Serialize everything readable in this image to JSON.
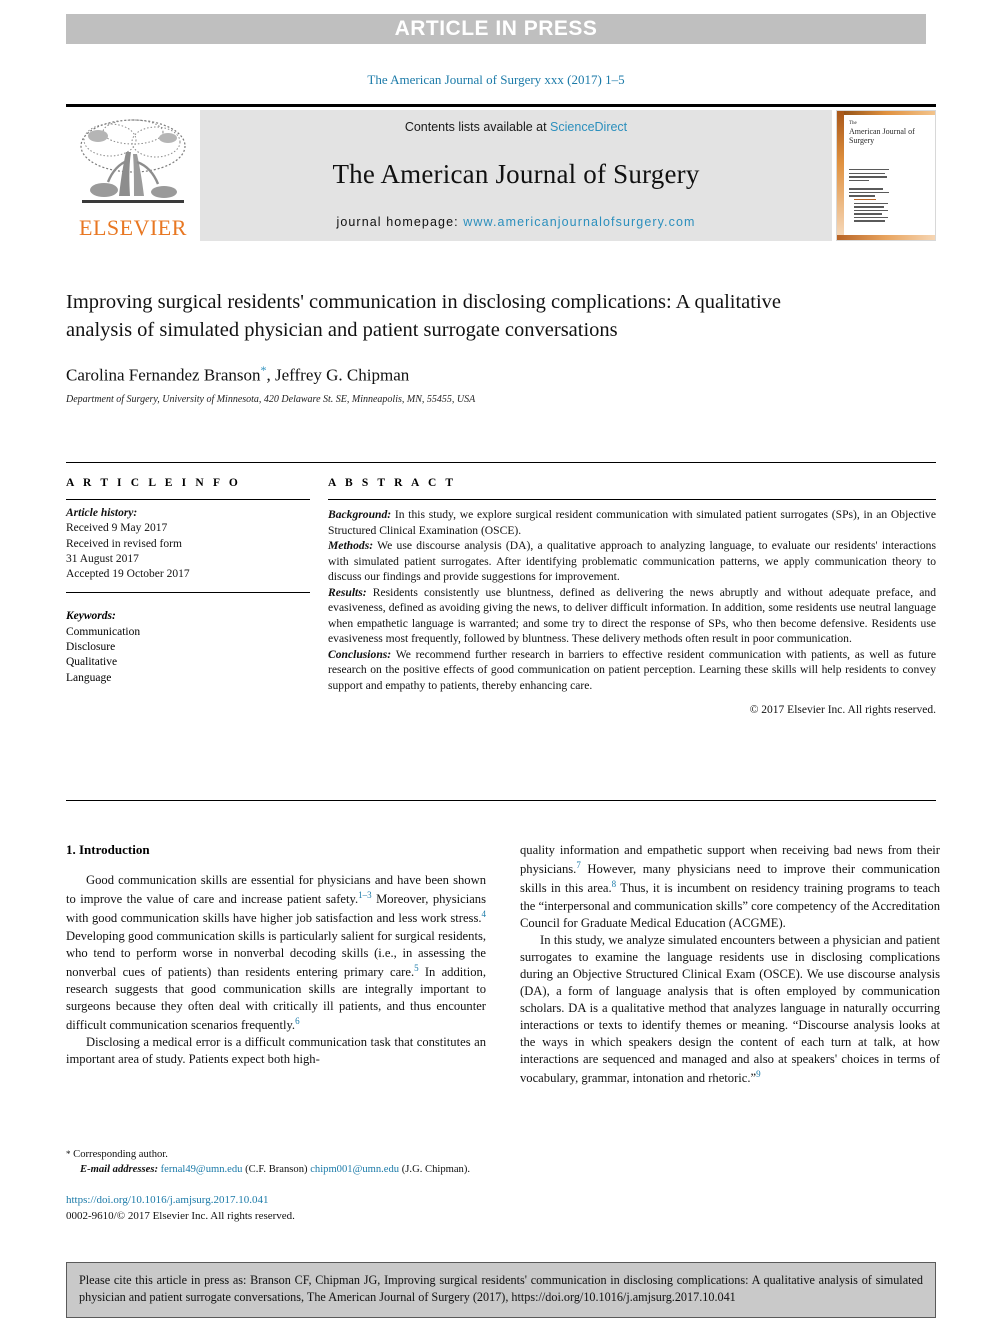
{
  "banner": {
    "text": "ARTICLE IN PRESS"
  },
  "journal_ref": "The American Journal of Surgery xxx (2017) 1–5",
  "masthead": {
    "contents_prefix": "Contents lists available at ",
    "sciencedirect": "ScienceDirect",
    "journal_title": "The American Journal of Surgery",
    "homepage_label": "journal homepage: ",
    "homepage_url": "www.americanjournalofsurgery.com",
    "publisher": "ELSEVIER",
    "cover_the": "The",
    "cover_title": "American Journal of Surgery"
  },
  "article": {
    "title": "Improving surgical residents' communication in disclosing complications: A qualitative analysis of simulated physician and patient surrogate conversations",
    "authors": "Carolina Fernandez Branson",
    "authors_second": ", Jeffrey G. Chipman",
    "corresponding_marker": "*",
    "affiliation": "Department of Surgery, University of Minnesota, 420 Delaware St. SE, Minneapolis, MN, 55455, USA"
  },
  "info": {
    "heading": "A R T I C L E   I N F O",
    "history_label": "Article history:",
    "history": [
      "Received 9 May 2017",
      "Received in revised form",
      "31 August 2017",
      "Accepted 19 October 2017"
    ],
    "keywords_label": "Keywords:",
    "keywords": [
      "Communication",
      "Disclosure",
      "Qualitative",
      "Language"
    ]
  },
  "abstract": {
    "heading": "A B S T R A C T",
    "sections": [
      {
        "label": "Background:",
        "text": " In this study, we explore surgical resident communication with simulated patient surrogates (SPs), in an Objective Structured Clinical Examination (OSCE)."
      },
      {
        "label": "Methods:",
        "text": " We use discourse analysis (DA), a qualitative approach to analyzing language, to evaluate our residents' interactions with simulated patient surrogates. After identifying problematic communication patterns, we apply communication theory to discuss our findings and provide suggestions for improvement."
      },
      {
        "label": "Results:",
        "text": " Residents consistently use bluntness, defined as delivering the news abruptly and without adequate preface, and evasiveness, defined as avoiding giving the news, to deliver difficult information. In addition, some residents use neutral language when empathetic language is warranted; and some try to direct the response of SPs, who then become defensive. Residents use evasiveness most frequently, followed by bluntness. These delivery methods often result in poor communication."
      },
      {
        "label": "Conclusions:",
        "text": " We recommend further research in barriers to effective resident communication with patients, as well as future research on the positive effects of good communication on patient perception. Learning these skills will help residents to convey support and empathy to patients, thereby enhancing care."
      }
    ],
    "copyright": "© 2017 Elsevier Inc. All rights reserved."
  },
  "body": {
    "section_heading": "1. Introduction",
    "left_paragraphs": [
      {
        "parts": [
          {
            "t": "Good communication skills are essential for physicians and have been shown to improve the value of care and increase patient safety."
          },
          {
            "ref": "1–3"
          },
          {
            "t": " Moreover, physicians with good communication skills have higher job satisfaction and less work stress."
          },
          {
            "ref": "4"
          },
          {
            "t": " Developing good communication skills is particularly salient for surgical residents, who tend to perform worse in nonverbal decoding skills (i.e., in assessing the nonverbal cues of patients) than residents entering primary care."
          },
          {
            "ref": "5"
          },
          {
            "t": " In addition, research suggests that good communication skills are integrally important to surgeons because they often deal with critically ill patients, and thus encounter difficult communication scenarios frequently."
          },
          {
            "ref": "6"
          }
        ]
      },
      {
        "parts": [
          {
            "t": "Disclosing a medical error is a difficult communication task that constitutes an important area of study. Patients expect both high-"
          }
        ]
      }
    ],
    "right_paragraphs": [
      {
        "no_indent": true,
        "parts": [
          {
            "t": "quality information and empathetic support when receiving bad news from their physicians."
          },
          {
            "ref": "7"
          },
          {
            "t": " However, many physicians need to improve their communication skills in this area."
          },
          {
            "ref": "8"
          },
          {
            "t": " Thus, it is incumbent on residency training programs to teach the “interpersonal and communication skills” core competency of the Accreditation Council for Graduate Medical Education (ACGME)."
          }
        ]
      },
      {
        "parts": [
          {
            "t": "In this study, we analyze simulated encounters between a physician and patient surrogates to examine the language residents use in disclosing complications during an Objective Structured Clinical Exam (OSCE). We use discourse analysis (DA), a form of language analysis that is often employed by communication scholars. DA is a qualitative method that analyzes language in naturally occurring interactions or texts to identify themes or meaning. “Discourse analysis looks at the ways in which speakers design the content of each turn at talk, at how interactions are sequenced and managed and also at speakers' choices in terms of vocabulary, grammar, intonation and rhetoric.”"
          },
          {
            "ref": "9"
          }
        ]
      }
    ]
  },
  "footnote": {
    "corresponding": "Corresponding author.",
    "email_label": "E-mail addresses:",
    "email_1": "fernal49@umn.edu",
    "email_1_owner": "(C.F. Branson)",
    "email_2": "chipm001@umn.edu",
    "email_2_owner": "(J.G. Chipman).",
    "doi": "https://doi.org/10.1016/j.amjsurg.2017.10.041",
    "issn_copyright": "0002-9610/© 2017 Elsevier Inc. All rights reserved."
  },
  "cite_box": {
    "text": "Please cite this article in press as: Branson CF, Chipman JG, Improving surgical residents' communication in disclosing complications: A qualitative analysis of simulated physician and patient surrogate conversations, The American Journal of Surgery (2017), https://doi.org/10.1016/j.amjsurg.2017.10.041"
  },
  "colors": {
    "link_blue": "#1b7aa8",
    "sciencedirect_blue": "#2b8fbd",
    "elsevier_orange": "#e87722",
    "banner_gray": "#bfbfbf",
    "masthead_gray": "#e3e3e3",
    "cite_box_gray": "#c9c9c9"
  }
}
